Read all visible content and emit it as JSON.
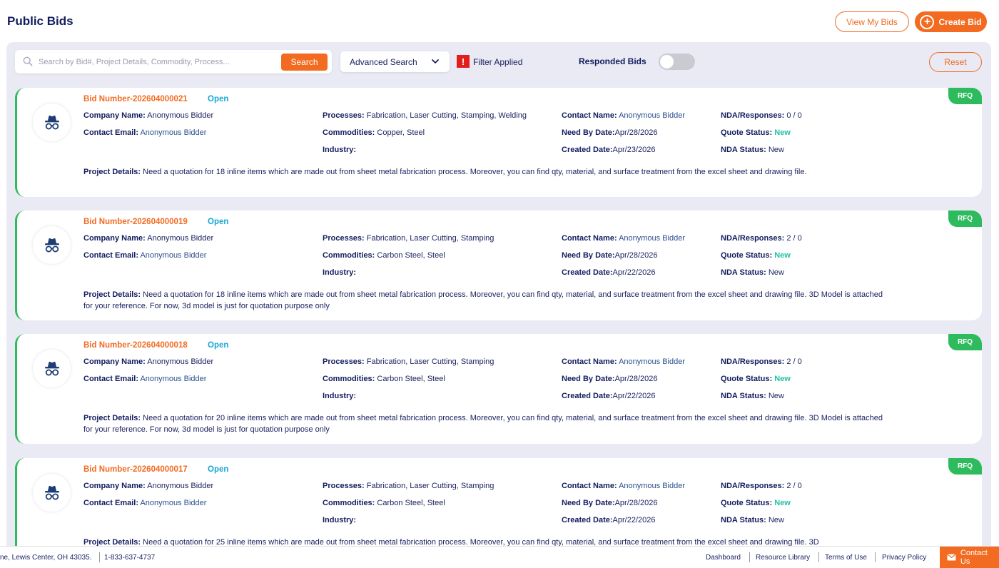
{
  "header": {
    "title": "Public Bids",
    "view_my_bids": "View My Bids",
    "create_bid": "Create Bid"
  },
  "toolbar": {
    "search_placeholder": "Search by Bid#, Project Details, Commodity, Process...",
    "search_button": "Search",
    "advanced_search": "Advanced Search",
    "filter_flag": "!",
    "filter_applied": "Filter Applied",
    "responded_bids": "Responded Bids",
    "responded_toggle_on": false,
    "reset": "Reset"
  },
  "labels": {
    "company_name": "Company Name:",
    "contact_email": "Contact Email:",
    "processes": "Processes:",
    "commodities": "Commodities:",
    "industry": "Industry:",
    "contact_name": "Contact Name:",
    "need_by_date": "Need By Date:",
    "created_date": "Created Date:",
    "nda_responses": "NDA/Responses:",
    "quote_status": "Quote Status:",
    "nda_status": "NDA Status:",
    "project_details": "Project Details:"
  },
  "bids": [
    {
      "bid_number": "Bid Number-202604000021",
      "status": "Open",
      "tag": "RFQ",
      "company_name": "Anonymous Bidder",
      "contact_email": "Anonymous Bidder",
      "processes": "Fabrication, Laser Cutting, Stamping, Welding",
      "commodities": "Copper, Steel",
      "industry": "",
      "contact_name": "Anonymous Bidder",
      "need_by_date": "Apr/28/2026",
      "created_date": "Apr/23/2026",
      "nda_responses": "0 / 0",
      "quote_status": "New",
      "nda_status": "New",
      "project_details": "Need a quotation for 18 inline items which are made out from sheet metal fabrication process. Moreover, you can find qty, material, and surface treatment from the excel sheet and drawing file."
    },
    {
      "bid_number": "Bid Number-202604000019",
      "status": "Open",
      "tag": "RFQ",
      "company_name": "Anonymous Bidder",
      "contact_email": "Anonymous Bidder",
      "processes": "Fabrication, Laser Cutting, Stamping",
      "commodities": "Carbon Steel, Steel",
      "industry": "",
      "contact_name": "Anonymous Bidder",
      "need_by_date": "Apr/28/2026",
      "created_date": "Apr/22/2026",
      "nda_responses": "2 / 0",
      "quote_status": "New",
      "nda_status": "New",
      "project_details": "Need a quotation for 18 inline items which are made out from sheet metal fabrication process. Moreover, you can find qty, material, and surface treatment from the excel sheet and drawing file. 3D Model is attached for your reference. For now, 3d model is just for quotation purpose only"
    },
    {
      "bid_number": "Bid Number-202604000018",
      "status": "Open",
      "tag": "RFQ",
      "company_name": "Anonymous Bidder",
      "contact_email": "Anonymous Bidder",
      "processes": "Fabrication, Laser Cutting, Stamping",
      "commodities": "Carbon Steel, Steel",
      "industry": "",
      "contact_name": "Anonymous Bidder",
      "need_by_date": "Apr/28/2026",
      "created_date": "Apr/22/2026",
      "nda_responses": "2 / 0",
      "quote_status": "New",
      "nda_status": "New",
      "project_details": "Need a quotation for 20 inline items which are made out from sheet metal fabrication process. Moreover, you can find qty, material, and surface treatment from the excel sheet and drawing file. 3D Model is attached for your reference. For now, 3d model is just for quotation purpose only"
    },
    {
      "bid_number": "Bid Number-202604000017",
      "status": "Open",
      "tag": "RFQ",
      "company_name": "Anonymous Bidder",
      "contact_email": "Anonymous Bidder",
      "processes": "Fabrication, Laser Cutting, Stamping",
      "commodities": "Carbon Steel, Steel",
      "industry": "",
      "contact_name": "Anonymous Bidder",
      "need_by_date": "Apr/28/2026",
      "created_date": "Apr/22/2026",
      "nda_responses": "2 / 0",
      "quote_status": "New",
      "nda_status": "New",
      "project_details": "Need a quotation for 25 inline items which are made out from sheet metal fabrication process. Moreover, you can find qty, material, and surface treatment from the excel sheet and drawing file. 3D"
    }
  ],
  "footer": {
    "address": "ne, Lewis Center, OH 43035.",
    "phone": "1-833-637-4737",
    "links": [
      "Dashboard",
      "Resource Library",
      "Terms of Use",
      "Privacy Policy"
    ],
    "contact_us": "Contact Us"
  },
  "colors": {
    "accent": "#f26b21",
    "navy": "#121c5e",
    "open_status": "#17a6d6",
    "green": "#2dbb5d",
    "new_status": "#22c1a0",
    "panel_bg": "#e9eaf3"
  }
}
